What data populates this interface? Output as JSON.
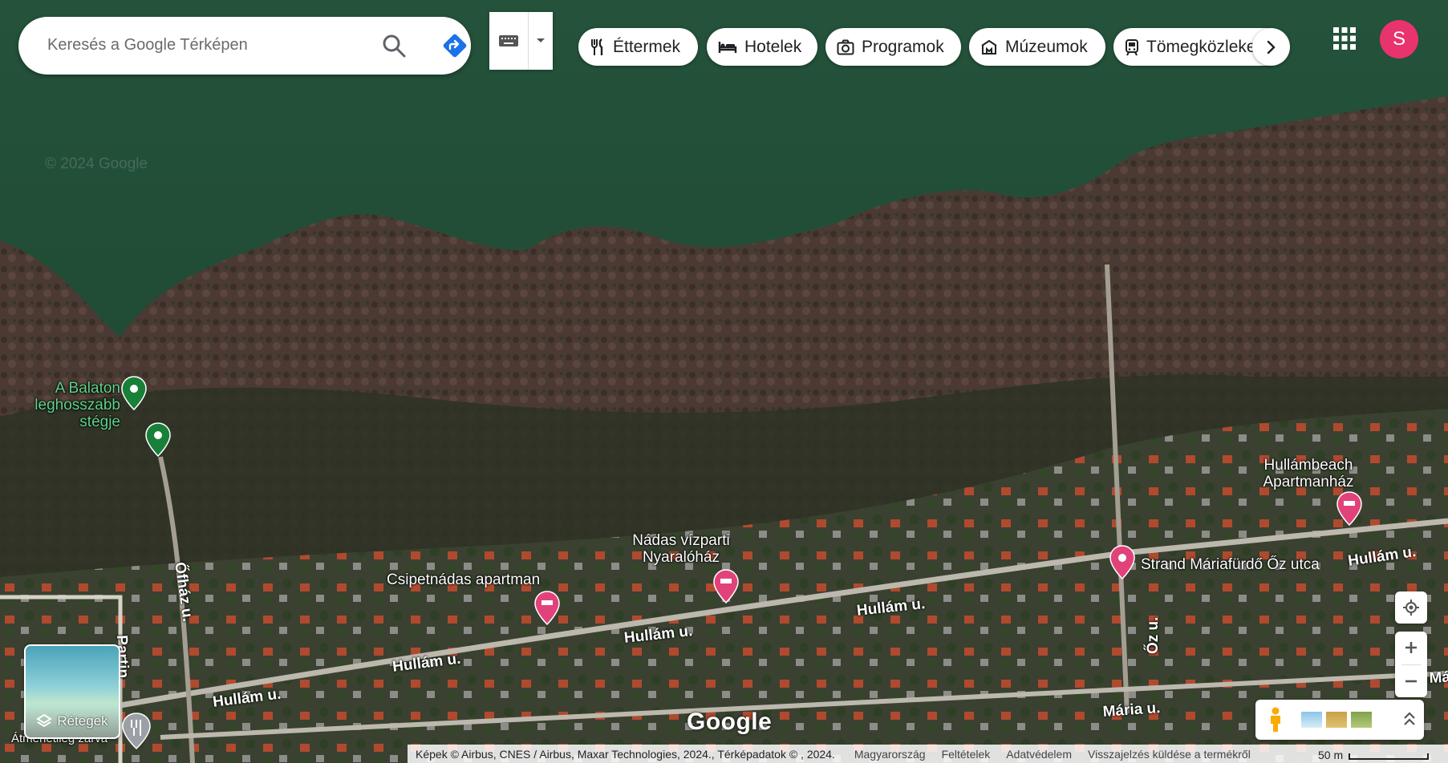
{
  "search": {
    "placeholder": "Keresés a Google Térképen"
  },
  "categories": [
    {
      "label": "Éttermek",
      "icon": "fork-knife-icon"
    },
    {
      "label": "Hotelek",
      "icon": "bed-icon"
    },
    {
      "label": "Programok",
      "icon": "camera-icon"
    },
    {
      "label": "Múzeumok",
      "icon": "museum-icon"
    },
    {
      "label": "Tömegközlekedés",
      "icon": "tram-icon"
    }
  ],
  "account": {
    "initial": "S",
    "color": "#e8336f"
  },
  "watermark": "© 2024 Google",
  "places": {
    "pier": "A Balaton leghosszabb stégje",
    "csipetnadas": "Csipetnádas apartman",
    "nadas": "Nádas vízparti Nyaralóház",
    "strand": "Strand Máriafürdő Őz utca",
    "hullambeach": "Hullámbeach Apartmanház",
    "atmenetileg": "Átmenetileg zárva"
  },
  "streets": {
    "hullam": "Hullám u.",
    "ofhaz": "Őfház u.",
    "partin": "Partin",
    "oz": "Őz u.",
    "maria": "Mária u.",
    "ma": "Má"
  },
  "layers": {
    "label": "Rétegek"
  },
  "logo": "Google",
  "footer": {
    "attribution": "Képek © Airbus, CNES / Airbus, Maxar Technologies, 2024., Térképadatok © , 2024.",
    "country": "Magyarország",
    "terms": "Feltételek",
    "privacy": "Adatvédelem",
    "feedback": "Visszajelzés küldése a termékről",
    "scale": "50 m"
  }
}
